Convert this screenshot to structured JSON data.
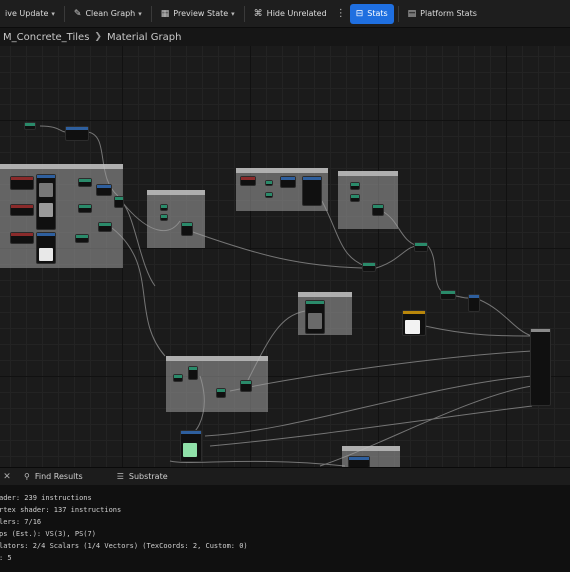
{
  "toolbar": {
    "live_update": "ive Update",
    "clean_graph": "Clean Graph",
    "preview_state": "Preview State",
    "hide_unrelated": "Hide Unrelated",
    "stats": "Stats",
    "platform_stats": "Platform Stats"
  },
  "breadcrumb": {
    "asset": "M_Concrete_Tiles",
    "graph": "Material Graph"
  },
  "bottom_tabs": {
    "find_results": "Find Results",
    "substrate": "Substrate"
  },
  "stats": {
    "lines": [
      "ader: 239 instructions",
      "rtex shader: 137 instructions",
      "lers: 7/16",
      "ps (Est.): VS(3), PS(7)",
      "lators: 2/4 Scalars (1/4 Vectors) (TexCoords: 2, Custom: 0)",
      ": 5"
    ]
  },
  "colors": {
    "accent": "#1f6fe0",
    "graph_bg": "#1b1b1b",
    "comment": "#a0a0a0"
  }
}
